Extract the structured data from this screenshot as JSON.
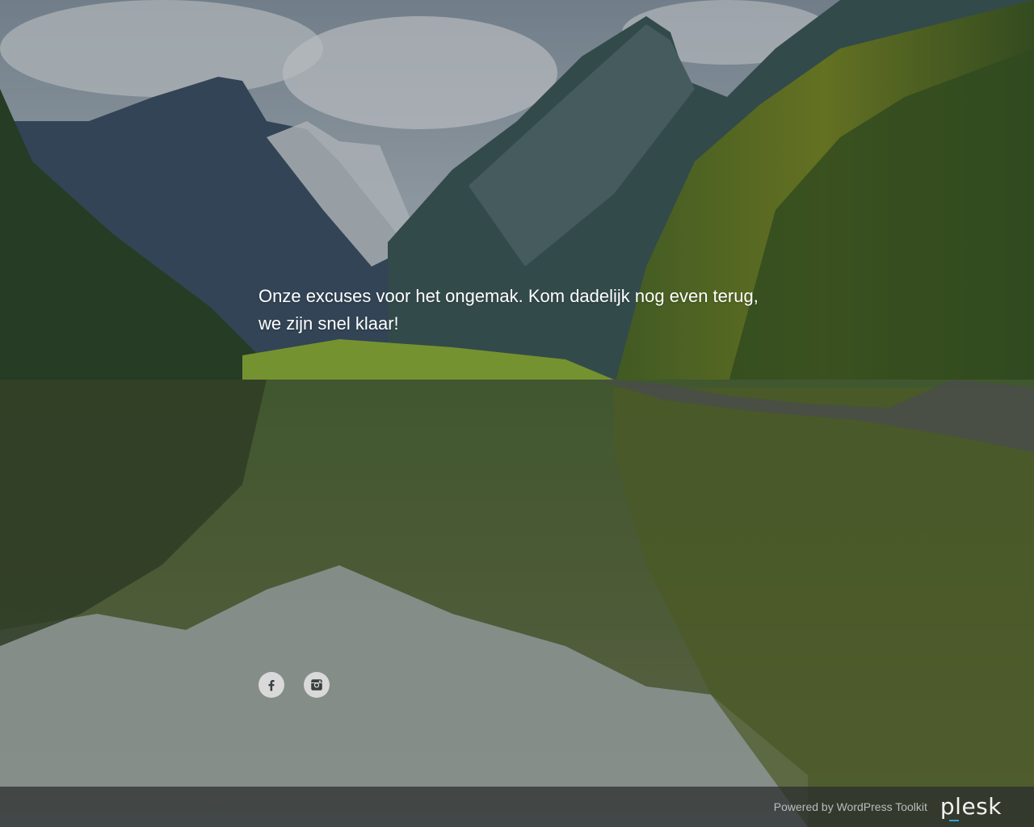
{
  "message": {
    "text": "Onze excuses voor het ongemak. Kom dadelijk nog even terug, we zijn snel klaar!"
  },
  "social": [
    {
      "name": "facebook",
      "icon": "facebook-icon"
    },
    {
      "name": "instagram",
      "icon": "instagram-icon"
    }
  ],
  "footer": {
    "powered_prefix": "Powered by ",
    "powered_link": "WordPress Toolkit",
    "logo_text": "plesk"
  },
  "colors": {
    "text": "#ffffff",
    "footer_bg": "#282d2d",
    "footer_text": "#b9bebe",
    "logo_accent": "#2ea4d8"
  }
}
